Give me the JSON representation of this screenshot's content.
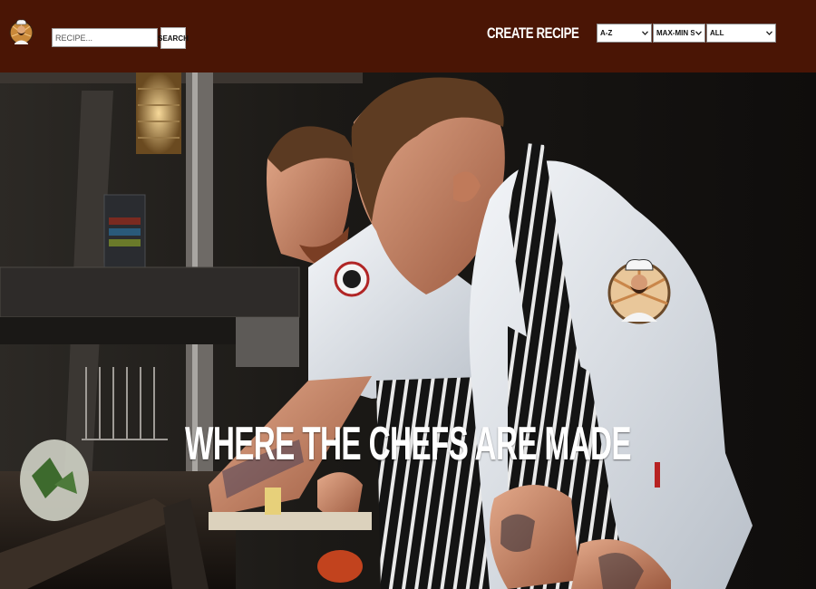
{
  "navbar": {
    "logo_icon": "chef-mascot-logo-icon",
    "search": {
      "placeholder": "RECIPE...",
      "value": "",
      "button_label": "SEARCH"
    },
    "create_link_label": "CREATE RECIPE",
    "sort_alpha": {
      "selected": "A-Z"
    },
    "sort_score": {
      "selected": "MAX-MIN SCORE"
    },
    "filter_diet": {
      "selected": "ALL"
    },
    "chevron_icon": "chevron-down-icon",
    "colors": {
      "navbar_bg": "#4a1505",
      "text": "#ffffff"
    }
  },
  "hero": {
    "title": "WHERE THE CHEFS ARE MADE",
    "image": "chefs-cooking-in-kitchen-photo"
  }
}
